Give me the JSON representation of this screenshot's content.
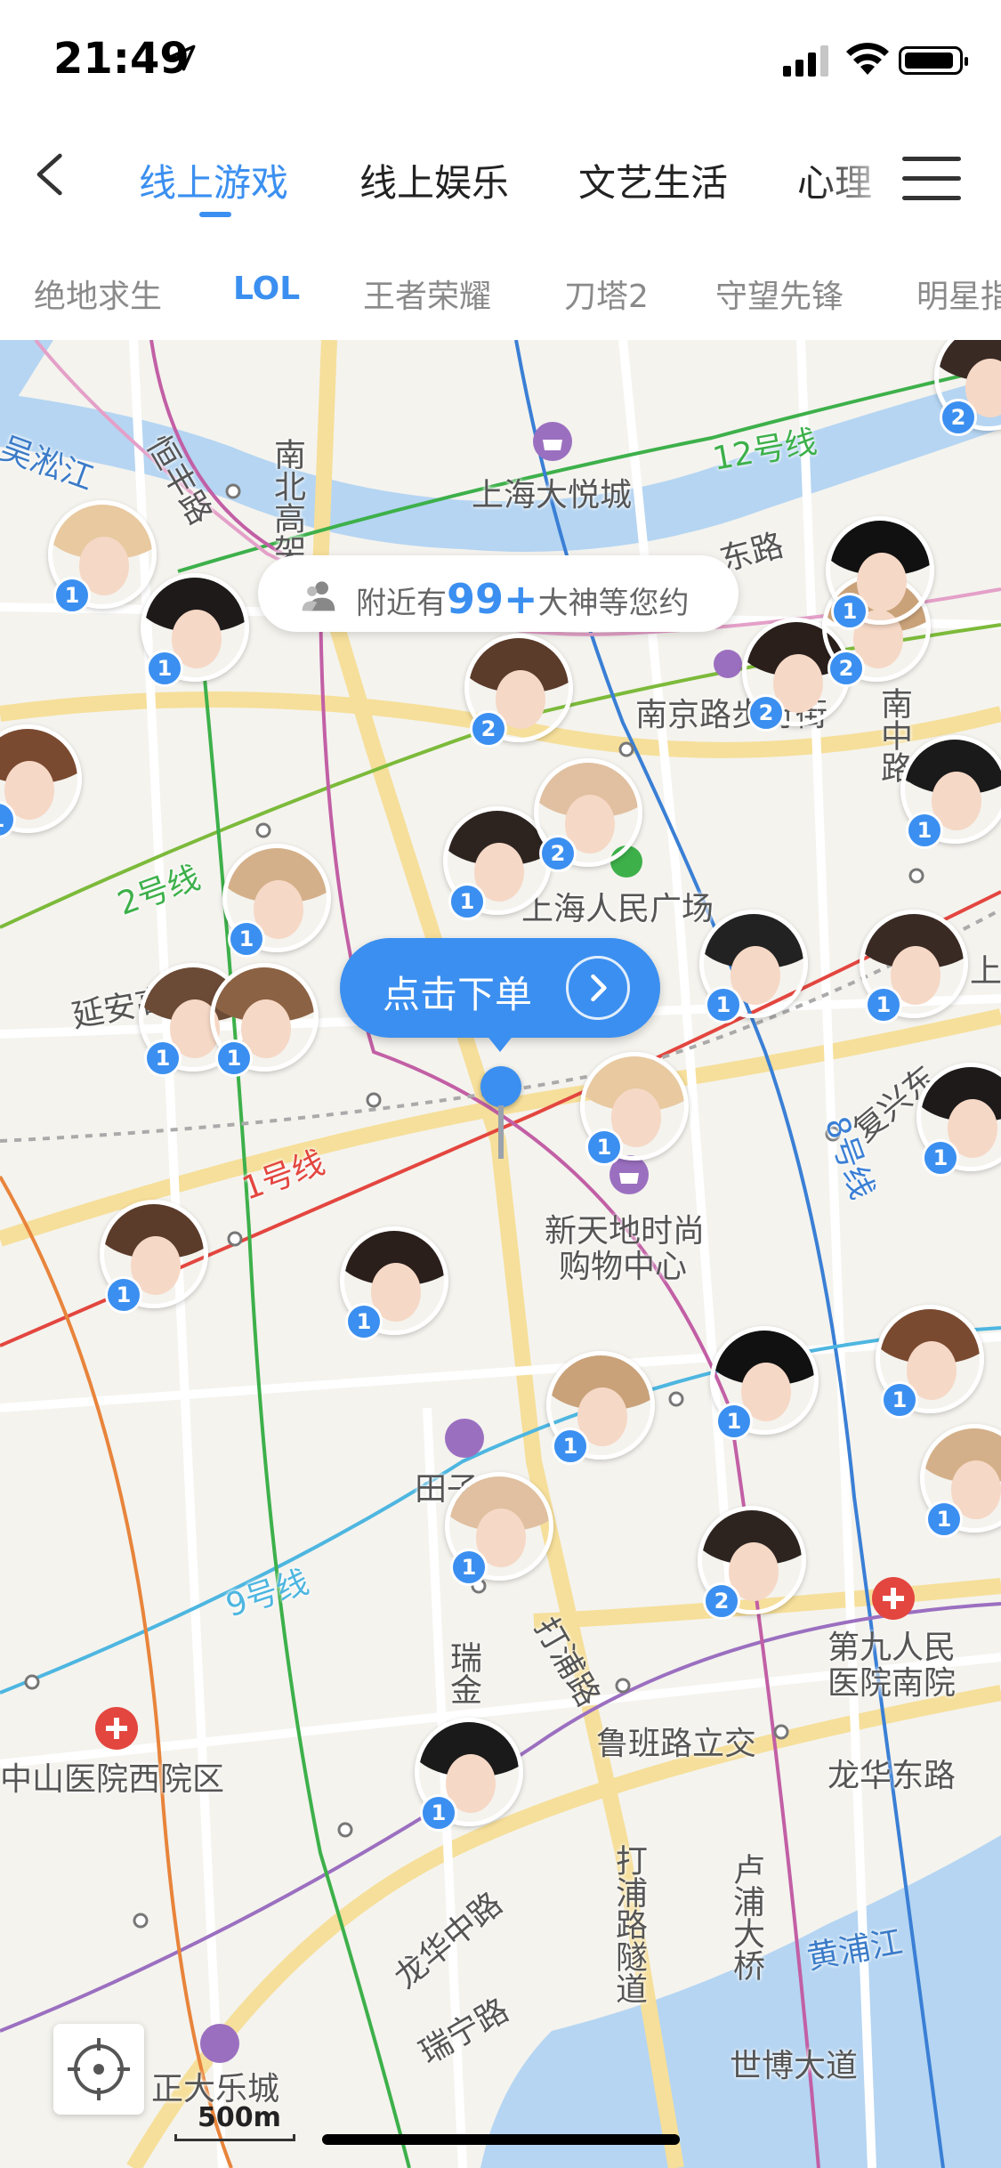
{
  "status": {
    "time": "21:49",
    "location_icon": "location-arrow-icon",
    "signal_icon": "cellular-signal-icon",
    "wifi_icon": "wifi-icon",
    "battery_icon": "battery-icon"
  },
  "nav": {
    "back_icon": "chevron-left-icon",
    "menu_icon": "hamburger-menu-icon",
    "tabs": [
      {
        "label": "线上游戏",
        "active": true
      },
      {
        "label": "线上娱乐",
        "active": false
      },
      {
        "label": "文艺生活",
        "active": false
      },
      {
        "label": "心理",
        "active": false
      }
    ]
  },
  "subtabs": [
    {
      "label": "绝地求生",
      "active": false
    },
    {
      "label": "LOL",
      "active": true
    },
    {
      "label": "王者荣耀",
      "active": false
    },
    {
      "label": "刀塔2",
      "active": false
    },
    {
      "label": "守望先锋",
      "active": false
    },
    {
      "label": "明星指",
      "active": false
    }
  ],
  "map": {
    "nearby": {
      "prefix": "附近有",
      "count": "99+",
      "suffix": "大神等您约",
      "icon": "people-icon"
    },
    "order_button": {
      "label": "点击下单",
      "icon": "chevron-right-circle-icon"
    },
    "scale": "500m",
    "locate_icon": "locate-crosshair-icon",
    "labels": {
      "wusong": "吴淞江",
      "hengfeng": "恒丰路",
      "nanbei": "南北高架",
      "line12": "12号线",
      "joycity": "上海大悦城",
      "dong": "东路",
      "nanjing": "南京路步行街",
      "nanzhong": "南中路",
      "line2": "2号线",
      "peoplesquare": "上海人民广场",
      "yanan": "延安高",
      "line1": "1号线",
      "fuxing": "复兴东",
      "line8": "8号线",
      "xintiandi1": "新天地时尚",
      "xintiandi2": "购物中心",
      "tianzi": "田子",
      "line9": "9号线",
      "ruijin": "瑞金",
      "dapu": "打浦路",
      "ninth1": "第九人民",
      "ninth2": "医院南院",
      "zhongshan": "中山医院西院区",
      "lubanlu": "鲁班路立交",
      "longhuadong": "龙华东路",
      "dapusuidao": "打浦路隧道",
      "lupu": "卢浦大桥",
      "huangpu": "黄浦江",
      "longhuazhong": "龙华中路",
      "ruining": "瑞宁路",
      "zhengda": "正大乐城",
      "shibo": "世博大道",
      "shang": "上海"
    },
    "avatar_badges": [
      "2",
      "1",
      "1",
      "2",
      "2",
      "2",
      "1",
      "1",
      "1",
      "1",
      "2",
      "1",
      "1",
      "1",
      "1",
      "1",
      "1",
      "1",
      "1",
      "1",
      "1",
      "1",
      "1",
      "1",
      "2",
      "1",
      "1"
    ],
    "colors": {
      "accent": "#3b8ff0",
      "line1": "#e3463f",
      "line2": "#7cba3a",
      "line8": "#3a7fd5",
      "line9": "#4db6e0",
      "line12": "#3db04a",
      "line13": "#e4a0c8",
      "purple_line": "#9b6fc0"
    }
  }
}
